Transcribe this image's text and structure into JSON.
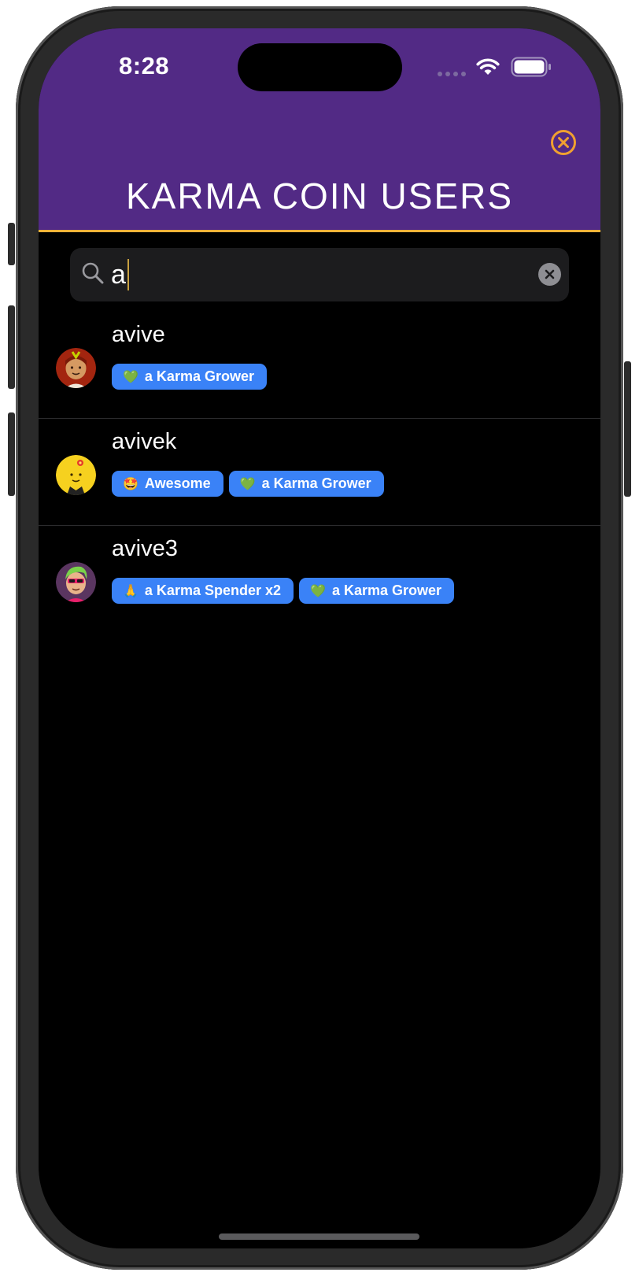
{
  "status_bar": {
    "time": "8:28"
  },
  "header": {
    "title": "KARMA COIN USERS",
    "close_icon": "close-circle-icon",
    "accent_color": "#f0b23a",
    "background_color": "#522a85"
  },
  "search": {
    "value": "a",
    "search_icon": "magnifier-icon",
    "clear_icon": "clear-circle-icon"
  },
  "users": [
    {
      "name": "avive",
      "avatar": "avatar-red-hair-icon",
      "badges": [
        {
          "emoji": "💚",
          "label": "a Karma Grower"
        }
      ]
    },
    {
      "name": "avivek",
      "avatar": "avatar-yellow-face-icon",
      "badges": [
        {
          "emoji": "🤩",
          "label": "Awesome"
        },
        {
          "emoji": "💚",
          "label": "a Karma Grower"
        }
      ]
    },
    {
      "name": "avive3",
      "avatar": "avatar-green-hair-icon",
      "badges": [
        {
          "emoji": "🙏",
          "label": "a Karma Spender x2"
        },
        {
          "emoji": "💚",
          "label": "a Karma Grower"
        }
      ]
    }
  ]
}
